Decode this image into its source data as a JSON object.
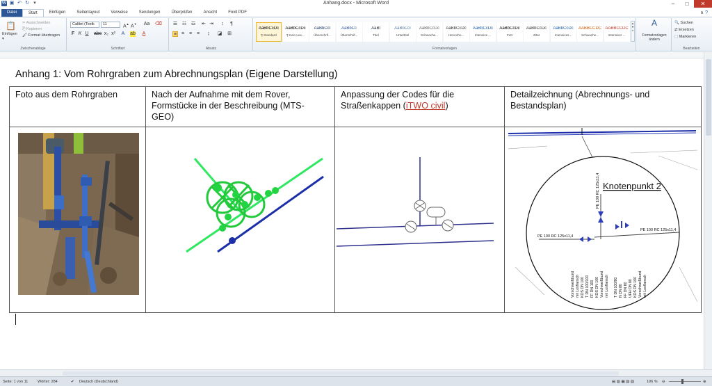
{
  "window": {
    "title": "Anhang.docx - Microsoft Word"
  },
  "tabs": [
    {
      "label": "Datei"
    },
    {
      "label": "Start"
    },
    {
      "label": "Einfügen"
    },
    {
      "label": "Seitenlayout"
    },
    {
      "label": "Verweise"
    },
    {
      "label": "Sendungen"
    },
    {
      "label": "Überprüfen"
    },
    {
      "label": "Ansicht"
    },
    {
      "label": "Foxit PDF"
    }
  ],
  "ribbon": {
    "clipboard": {
      "paste": "Einfügen",
      "cut": "Ausschneiden",
      "copy": "Kopieren",
      "format_painter": "Format übertragen",
      "label": "Zwischenablage"
    },
    "font": {
      "font_name": "Calibri (Textk",
      "font_size": "11",
      "label": "Schriftart"
    },
    "paragraph": {
      "label": "Absatz"
    },
    "styles": {
      "label": "Formatvorlagen",
      "change_styles": "Formatvorlagen ändern",
      "items": [
        {
          "sample": "AaBbCcDc",
          "name": "¶ Standard",
          "color": "#000000"
        },
        {
          "sample": "AaBbCcDc",
          "name": "¶ Kein Lee...",
          "color": "#000000"
        },
        {
          "sample": "AaBbCcI",
          "name": "Überschrif...",
          "color": "#1f3864"
        },
        {
          "sample": "AaBbCc",
          "name": "Überschrif...",
          "color": "#2e5597"
        },
        {
          "sample": "AaBl",
          "name": "Titel",
          "color": "#1f2d3d"
        },
        {
          "sample": "AaBbCcI",
          "name": "Untertitel",
          "color": "#5b7ba6"
        },
        {
          "sample": "AaBbCcDc",
          "name": "Schwache...",
          "color": "#666666"
        },
        {
          "sample": "AaBbCcDc",
          "name": "Hervorhe...",
          "color": "#333333"
        },
        {
          "sample": "AaBbCcDc",
          "name": "Intensive ...",
          "color": "#1f5fa6"
        },
        {
          "sample": "AaBbCcDc",
          "name": "Fett",
          "color": "#000000"
        },
        {
          "sample": "AaBbCcDc",
          "name": "Zitat",
          "color": "#333333"
        },
        {
          "sample": "AaBbCcDc",
          "name": "Intensives...",
          "color": "#1f5fa6"
        },
        {
          "sample": "AABBCCDC",
          "name": "Schwache...",
          "color": "#d35400"
        },
        {
          "sample": "AABBCCDC",
          "name": "Intensiver ...",
          "color": "#c0392b"
        }
      ]
    },
    "editing": {
      "find": "Suchen",
      "replace": "Ersetzen",
      "select": "Markieren",
      "label": "Bearbeiten"
    }
  },
  "document": {
    "heading": "Anhang 1: Vom Rohrgraben zum Abrechnungsplan (Eigene Darstellung)",
    "columns": [
      {
        "line1": "Foto aus dem Rohrgraben",
        "line2": "",
        "line3": ""
      },
      {
        "line1": "Nach der Aufnahme mit dem Rover,",
        "line2": "Formstücke in der Beschreibung (MTS-",
        "line3": "GEO)"
      },
      {
        "line1": "Anpassung der Codes für die",
        "line2_prefix": "Straßenkappen (",
        "line2_link": "iTWO civil",
        "line2_suffix": ")"
      },
      {
        "line1": "Detailzeichnung (Abrechnungs- und",
        "line2": "Bestandsplan)"
      }
    ],
    "drawing": {
      "knot_title": "Knotenpunkt 2",
      "pipe_label_left": "PE 100 RC 125x11,4",
      "pipe_label_right": "PE 100 RC 125x11,4",
      "pipe_label_vertical": "PE 100 RC 125x11,4",
      "fitting_labels": [
        "Vorschweißbund",
        "mit Losflansch",
        "KOS DN 100",
        "T DN 100/100",
        "FF DN 100",
        "KOS DN 100",
        "Vorschweißbund",
        "mit Losflansch",
        "T DN 100/80",
        "N DN 80",
        "FF DN 80",
        "UFH DN 80",
        "KOS DN 100",
        "Vorschweißbund",
        "mit Losflansch"
      ]
    }
  },
  "statusbar": {
    "page": "Seite: 1 von 11",
    "words": "Wörter: 284",
    "language": "Deutsch (Deutschland)",
    "zoom": "196 %"
  }
}
